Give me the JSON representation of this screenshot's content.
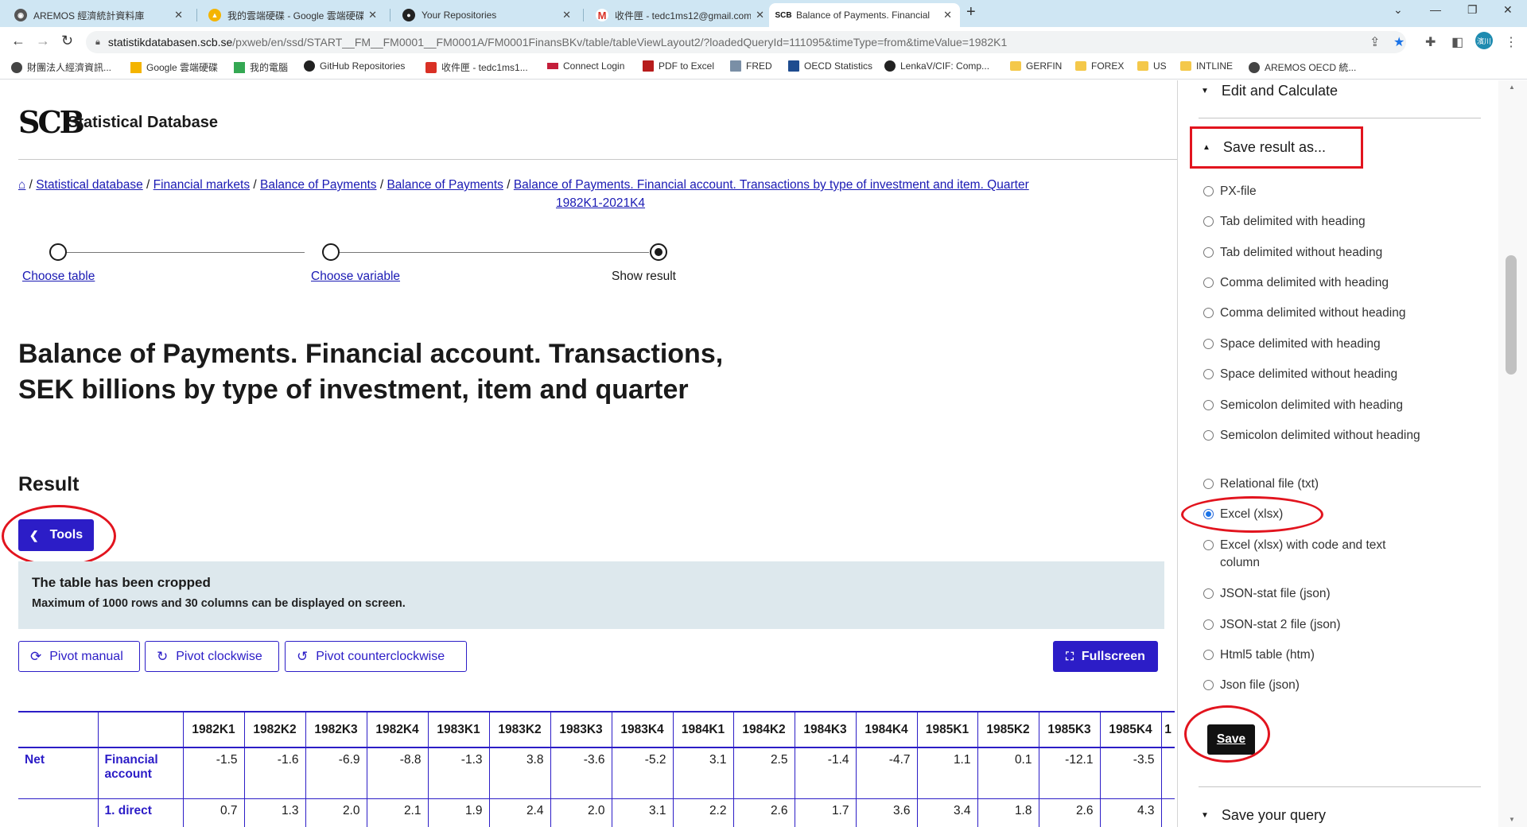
{
  "browser": {
    "tabs": [
      {
        "title": "AREMOS 經濟統計資料庫",
        "icon": "globe-icon"
      },
      {
        "title": "我的雲端硬碟 - Google 雲端硬碟",
        "icon": "google-drive-icon"
      },
      {
        "title": "Your Repositories",
        "icon": "github-icon"
      },
      {
        "title": "收件匣 - tedc1ms12@gmail.com",
        "icon": "gmail-icon"
      },
      {
        "title": "Balance of Payments. Financial",
        "icon": "scb-icon"
      }
    ],
    "url_host": "statistikdatabasen.scb.se",
    "url_path": "/pxweb/en/ssd/START__FM__FM0001__FM0001A/FM0001FinansBKv/table/tableViewLayout2/?loadedQueryId=111095&timeType=from&timeValue=1982K1",
    "profile_label": "濱川",
    "bookmarks": [
      {
        "label": "財團法人經濟資訊...",
        "kind": "site"
      },
      {
        "label": "Google 雲端硬碟",
        "kind": "site"
      },
      {
        "label": "我的電腦",
        "kind": "site"
      },
      {
        "label": "GitHub Repositories",
        "kind": "site"
      },
      {
        "label": "收件匣 - tedc1ms1...",
        "kind": "site"
      },
      {
        "label": "Connect Login",
        "kind": "site"
      },
      {
        "label": "PDF to Excel",
        "kind": "site"
      },
      {
        "label": "FRED",
        "kind": "site"
      },
      {
        "label": "OECD Statistics",
        "kind": "site"
      },
      {
        "label": "LenkaV/CIF: Comp...",
        "kind": "site"
      },
      {
        "label": "GERFIN",
        "kind": "folder"
      },
      {
        "label": "FOREX",
        "kind": "folder"
      },
      {
        "label": "US",
        "kind": "folder"
      },
      {
        "label": "INTLINE",
        "kind": "folder"
      },
      {
        "label": "AREMOS OECD 統...",
        "kind": "site"
      }
    ]
  },
  "header": {
    "logo_text": "SCB",
    "site_title": "Statistical Database"
  },
  "breadcrumb": {
    "home_icon": "⌂",
    "items": [
      "Statistical database",
      "Financial markets",
      "Balance of Payments",
      "Balance of Payments"
    ],
    "current_line1": "Balance of Payments. Financial account. Transactions by type of investment and item. Quarter",
    "current_line2": "1982K1-2021K4"
  },
  "stepper": {
    "steps": [
      "Choose table",
      "Choose variable",
      "Show result"
    ]
  },
  "page_title": "Balance of Payments. Financial account. Transactions, SEK billions by type of investment, item and quarter",
  "result_heading": "Result",
  "tools_button": "Tools",
  "notice": {
    "title": "The table has been cropped",
    "text": "Maximum of 1000 rows and 30 columns can be displayed on screen."
  },
  "pivot_buttons": {
    "manual": "Pivot manual",
    "clockwise": "Pivot clockwise",
    "counterclockwise": "Pivot counterclockwise",
    "fullscreen": "Fullscreen"
  },
  "table": {
    "columns": [
      "1982K1",
      "1982K2",
      "1982K3",
      "1982K4",
      "1983K1",
      "1983K2",
      "1983K3",
      "1983K4",
      "1984K1",
      "1984K2",
      "1984K3",
      "1984K4",
      "1985K1",
      "1985K2",
      "1985K3",
      "1985K4",
      "1"
    ],
    "rows": [
      {
        "group": "Net",
        "item": "Financial account",
        "values": [
          "-1.5",
          "-1.6",
          "-6.9",
          "-8.8",
          "-1.3",
          "3.8",
          "-3.6",
          "-5.2",
          "3.1",
          "2.5",
          "-1.4",
          "-4.7",
          "1.1",
          "0.1",
          "-12.1",
          "-3.5",
          ""
        ]
      },
      {
        "group": "",
        "item": "1. direct",
        "values": [
          "0.7",
          "1.3",
          "2.0",
          "2.1",
          "1.9",
          "2.4",
          "2.0",
          "3.1",
          "2.2",
          "2.6",
          "1.7",
          "3.6",
          "3.4",
          "1.8",
          "2.6",
          "4.3",
          ""
        ]
      }
    ]
  },
  "sidebar": {
    "edit_calculate": "Edit and Calculate",
    "save_result_as": "Save result as...",
    "formats": [
      {
        "label": "PX-file",
        "selected": false
      },
      {
        "label": "Tab delimited with heading",
        "selected": false
      },
      {
        "label": "Tab delimited without heading",
        "selected": false
      },
      {
        "label": "Comma delimited with heading",
        "selected": false
      },
      {
        "label": "Comma delimited without heading",
        "selected": false
      },
      {
        "label": "Space delimited with heading",
        "selected": false
      },
      {
        "label": "Space delimited without heading",
        "selected": false
      },
      {
        "label": "Semicolon delimited with heading",
        "selected": false
      },
      {
        "label": "Semicolon delimited without heading",
        "selected": false
      },
      {
        "label": "Relational file (txt)",
        "selected": false
      },
      {
        "label": "Excel (xlsx)",
        "selected": true
      },
      {
        "label": "Excel (xlsx) with code and text column",
        "selected": false
      },
      {
        "label": "JSON-stat file (json)",
        "selected": false
      },
      {
        "label": "JSON-stat 2 file (json)",
        "selected": false
      },
      {
        "label": "Html5 table (htm)",
        "selected": false
      },
      {
        "label": "Json file (json)",
        "selected": false
      }
    ],
    "save_button": "Save",
    "save_query": "Save your query"
  },
  "colors": {
    "primary": "#2c1dc7",
    "notice_bg": "#dde8ed",
    "annotation": "#e2141e",
    "tabstrip": "#cfe6f3"
  }
}
